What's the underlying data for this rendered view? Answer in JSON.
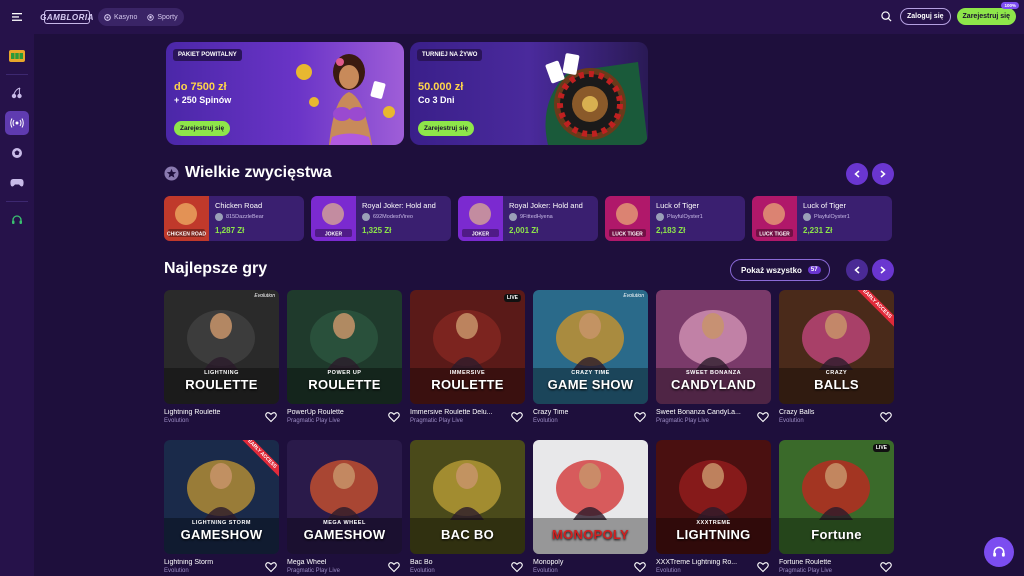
{
  "header": {
    "logo_text": "GAMBLORIA",
    "tabs": [
      {
        "label": "Kasyno",
        "icon": "casino-chip-icon"
      },
      {
        "label": "Sporty",
        "icon": "soccer-ball-icon"
      }
    ],
    "login_label": "Zaloguj się",
    "register_label": "Zarejestruj się",
    "register_tag": "100%"
  },
  "sidebar": {
    "items": [
      {
        "icon": "slot-machine-icon",
        "active": false
      },
      {
        "icon": "cherries-icon",
        "active": false
      },
      {
        "icon": "live-broadcast-icon",
        "active": true
      },
      {
        "icon": "soccer-ball-icon",
        "active": false
      },
      {
        "icon": "gamepad-icon",
        "active": false
      },
      {
        "icon": "headset-icon",
        "active": false
      }
    ]
  },
  "promos": [
    {
      "badge": "PAKIET POWITALNY",
      "amount": "do 7500 zł",
      "sub": "+ 250 Spinów",
      "cta": "Zarejestruj się"
    },
    {
      "badge": "TURNIEJ NA ŻYWO",
      "amount": "50.000 zł",
      "sub": "Co 3 Dni",
      "cta": "Zarejestruj się"
    }
  ],
  "big_wins": {
    "title": "Wielkie zwycięstwa",
    "items": [
      {
        "game": "Chicken Road",
        "user": "815DazzleBear",
        "amount": "1,287 Zł",
        "thumb_text": "CHICKEN ROAD",
        "color": "#c0392b"
      },
      {
        "game": "Royal Joker: Hold and",
        "user": "692ModestVireo",
        "amount": "1,325 Zł",
        "thumb_text": "JOKER",
        "color": "#7b2ad0"
      },
      {
        "game": "Royal Joker: Hold and",
        "user": "9FittedHyena",
        "amount": "2,001 Zł",
        "thumb_text": "JOKER",
        "color": "#7b2ad0"
      },
      {
        "game": "Luck of Tiger",
        "user": "PlayfulOyster1",
        "amount": "2,183 Zł",
        "thumb_text": "LUCK TIGER",
        "color": "#b0186a"
      },
      {
        "game": "Luck of Tiger",
        "user": "PlayfulOyster1",
        "amount": "2,231 Zł",
        "thumb_text": "LUCK TIGER",
        "color": "#b0186a"
      }
    ]
  },
  "top_games": {
    "title": "Najlepsze gry",
    "show_all_label": "Pokaż wszystko",
    "show_all_count": "57",
    "rows": [
      [
        {
          "name": "Lightning Roulette",
          "provider": "Evolution",
          "title": "ROULETTE",
          "sup": "LIGHTNING",
          "bg": "#2a2a2a",
          "accent": "#444",
          "badge": "evo"
        },
        {
          "name": "PowerUp Roulette",
          "provider": "Pragmatic Play Live",
          "title": "ROULETTE",
          "sup": "POWER UP",
          "bg": "#1f3a2c",
          "accent": "#2d5a42",
          "badge": "none"
        },
        {
          "name": "Immersive Roulette Delu...",
          "provider": "Pragmatic Play Live",
          "title": "ROULETTE",
          "sup": "IMMERSIVE",
          "bg": "#5a1a18",
          "accent": "#8a2a22",
          "badge": "live"
        },
        {
          "name": "Crazy Time",
          "provider": "Evolution",
          "title": "GAME SHOW",
          "sup": "CRAZY TIME",
          "bg": "#2a6a8a",
          "accent": "#e09a20",
          "badge": "evo"
        },
        {
          "name": "Sweet Bonanza CandyLa...",
          "provider": "Pragmatic Play Live",
          "title": "CANDYLAND",
          "sup": "SWEET BONANZA",
          "bg": "#7a3a6a",
          "accent": "#e0a0c0",
          "badge": "none"
        },
        {
          "name": "Crazy Balls",
          "provider": "Evolution",
          "title": "BALLS",
          "sup": "CRAZY",
          "bg": "#4a2a1a",
          "accent": "#d04a8a",
          "badge": "early"
        }
      ],
      [
        {
          "name": "Lightning Storm",
          "provider": "Evolution",
          "title": "GAMESHOW",
          "sup": "LIGHTNING STORM",
          "bg": "#1a2a4a",
          "accent": "#d0a030",
          "badge": "early"
        },
        {
          "name": "Mega Wheel",
          "provider": "Pragmatic Play Live",
          "title": "GAMESHOW",
          "sup": "MEGA WHEEL",
          "bg": "#2a1a4a",
          "accent": "#e05a2a",
          "badge": "none"
        },
        {
          "name": "Bac Bo",
          "provider": "Evolution",
          "title": "BAC BO",
          "sup": "",
          "bg": "#4a4a1a",
          "accent": "#c8a83a",
          "badge": "none"
        },
        {
          "name": "Monopoly",
          "provider": "Evolution",
          "title": "MONOPOLY",
          "sup": "",
          "bg": "#e8e8ea",
          "accent": "#d02020",
          "badge": "none"
        },
        {
          "name": "XXXTreme Lightning Ro...",
          "provider": "Evolution",
          "title": "LIGHTNING",
          "sup": "XXXTREME",
          "bg": "#4a1010",
          "accent": "#a02020",
          "badge": "none"
        },
        {
          "name": "Fortune Roulette",
          "provider": "Pragmatic Play Live",
          "title": "Fortune",
          "sup": "",
          "bg": "#3a6a2a",
          "accent": "#d02020",
          "badge": "live"
        }
      ]
    ]
  }
}
